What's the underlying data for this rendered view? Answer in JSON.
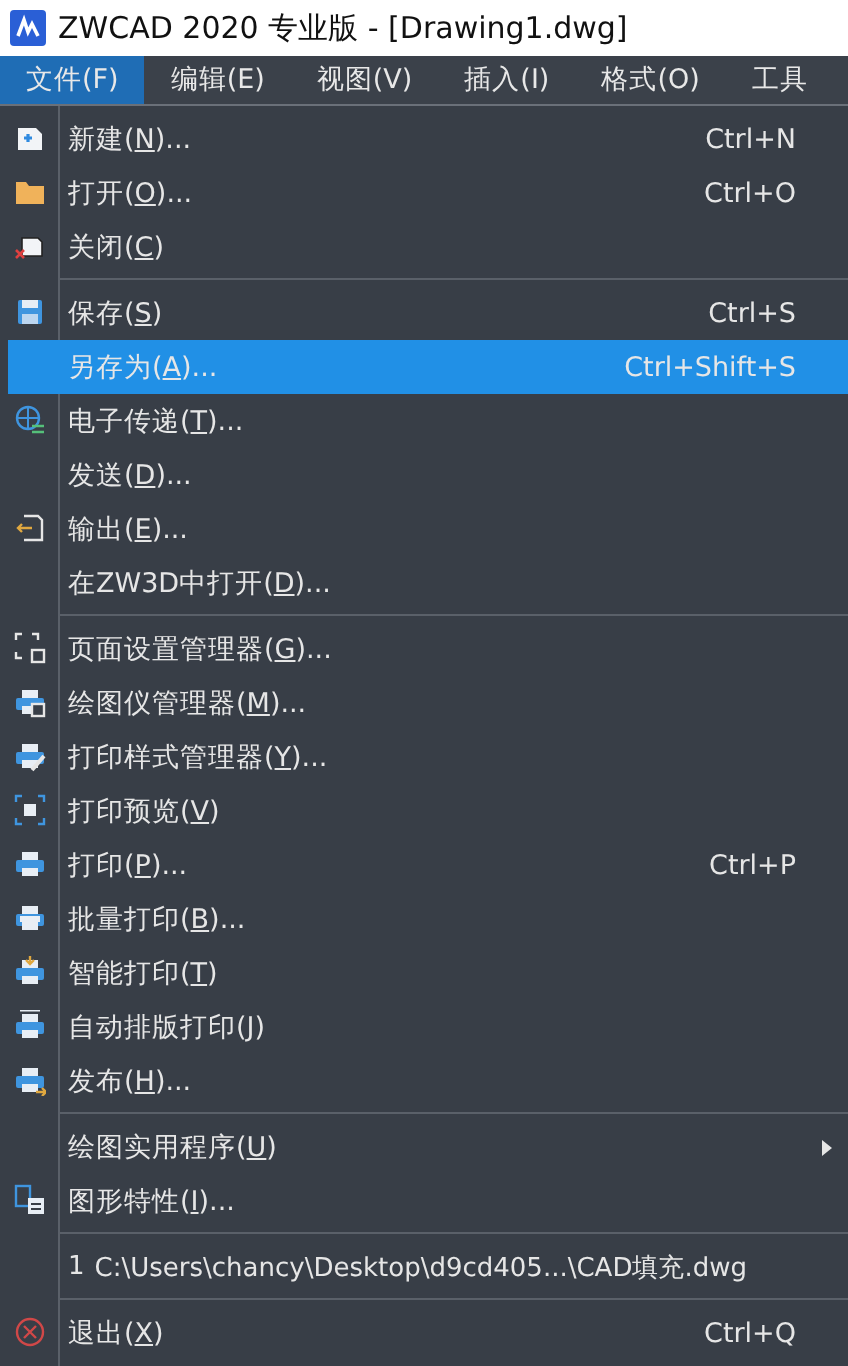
{
  "window": {
    "title": "ZWCAD 2020 专业版 - [Drawing1.dwg]"
  },
  "menubar": {
    "items": [
      {
        "label": "文件(F)",
        "selected": true
      },
      {
        "label": "编辑(E)",
        "selected": false
      },
      {
        "label": "视图(V)",
        "selected": false
      },
      {
        "label": "插入(I)",
        "selected": false
      },
      {
        "label": "格式(O)",
        "selected": false
      },
      {
        "label": "工具",
        "selected": false
      }
    ]
  },
  "menu": {
    "items": [
      {
        "kind": "item",
        "pre": "新建(",
        "key": "N",
        "post": ")...",
        "shortcut": "Ctrl+N",
        "selected": false
      },
      {
        "kind": "item",
        "pre": "打开(",
        "key": "O",
        "post": ")...",
        "shortcut": "Ctrl+O",
        "selected": false
      },
      {
        "kind": "item",
        "pre": "关闭(",
        "key": "C",
        "post": ")",
        "selected": false
      },
      {
        "kind": "separator"
      },
      {
        "kind": "item",
        "pre": "保存(",
        "key": "S",
        "post": ")",
        "shortcut": "Ctrl+S",
        "selected": false
      },
      {
        "kind": "item",
        "pre": "另存为(",
        "key": "A",
        "post": ")...",
        "shortcut": "Ctrl+Shift+S",
        "selected": true
      },
      {
        "kind": "item",
        "pre": "电子传递(",
        "key": "T",
        "post": ")...",
        "selected": false
      },
      {
        "kind": "item",
        "pre": "发送(",
        "key": "D",
        "post": ")...",
        "selected": false
      },
      {
        "kind": "item",
        "pre": "输出(",
        "key": "E",
        "post": ")...",
        "selected": false
      },
      {
        "kind": "item",
        "pre": "在ZW3D中打开(",
        "key": "D",
        "post": ")...",
        "selected": false
      },
      {
        "kind": "separator"
      },
      {
        "kind": "item",
        "pre": "页面设置管理器(",
        "key": "G",
        "post": ")...",
        "selected": false
      },
      {
        "kind": "item",
        "pre": "绘图仪管理器(",
        "key": "M",
        "post": ")...",
        "selected": false
      },
      {
        "kind": "item",
        "pre": "打印样式管理器(",
        "key": "Y",
        "post": ")...",
        "selected": false
      },
      {
        "kind": "item",
        "pre": "打印预览(",
        "key": "V",
        "post": ")",
        "selected": false
      },
      {
        "kind": "item",
        "pre": "打印(",
        "key": "P",
        "post": ")...",
        "shortcut": "Ctrl+P",
        "selected": false
      },
      {
        "kind": "item",
        "pre": "批量打印(",
        "key": "B",
        "post": ")...",
        "selected": false
      },
      {
        "kind": "item",
        "pre": "智能打印(",
        "key": "T",
        "post": ")",
        "selected": false
      },
      {
        "kind": "item",
        "pre": "自动排版打印(",
        "key": "J",
        "post": ")",
        "selected": false
      },
      {
        "kind": "item",
        "pre": "发布(",
        "key": "H",
        "post": ")...",
        "selected": false
      },
      {
        "kind": "separator"
      },
      {
        "kind": "item",
        "pre": "绘图实用程序(",
        "key": "U",
        "post": ")",
        "submenu": true,
        "selected": false
      },
      {
        "kind": "item",
        "pre": "图形特性(",
        "key": "I",
        "post": ")...",
        "selected": false
      },
      {
        "kind": "separator"
      },
      {
        "kind": "recent",
        "number": "1",
        "path": "C:\\Users\\chancy\\Desktop\\d9cd405...\\CAD填充.dwg",
        "selected": false
      },
      {
        "kind": "separator"
      },
      {
        "kind": "item",
        "pre": "退出(",
        "key": "X",
        "post": ")",
        "shortcut": "Ctrl+Q",
        "selected": false
      }
    ]
  }
}
